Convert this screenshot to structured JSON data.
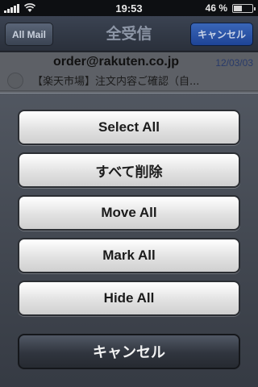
{
  "status_bar": {
    "time": "19:53",
    "battery_label": "46 %",
    "battery_level": 0.46
  },
  "nav": {
    "back_label": "All Mail",
    "title": "全受信",
    "cancel_label": "キャンセル"
  },
  "mail_list": {
    "items": [
      {
        "from": "order@rakuten.co.jp",
        "date": "12/03/03",
        "subject": "【楽天市場】注文内容ご確認（自..."
      }
    ]
  },
  "action_sheet": {
    "buttons": [
      {
        "label": "Select All"
      },
      {
        "label": "すべて削除"
      },
      {
        "label": "Move All"
      },
      {
        "label": "Mark All"
      },
      {
        "label": "Hide All"
      }
    ],
    "cancel_label": "キャンセル"
  },
  "colors": {
    "nav_cancel": "#2a55a8",
    "date_text": "#283a6a"
  }
}
